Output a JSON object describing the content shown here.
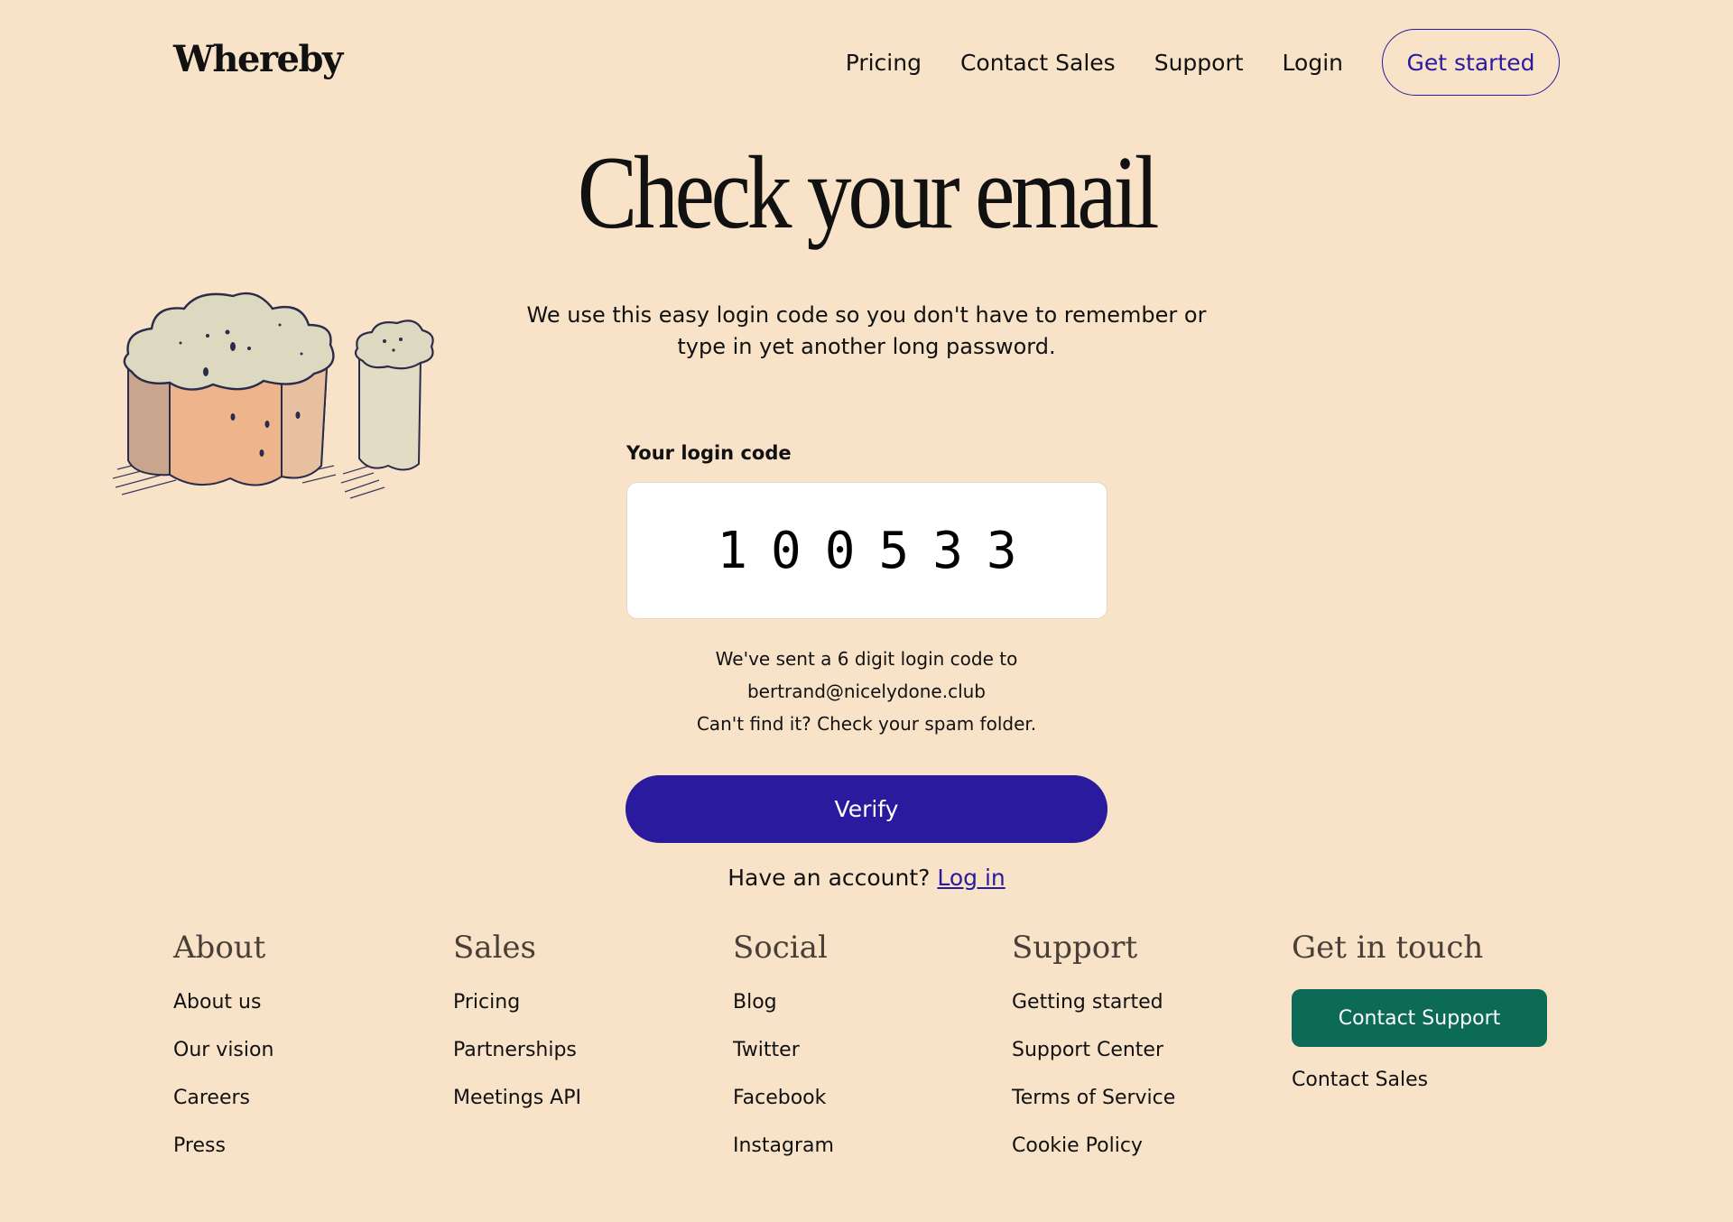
{
  "header": {
    "logo": "Whereby",
    "nav": [
      "Pricing",
      "Contact Sales",
      "Support",
      "Login"
    ],
    "cta": "Get started"
  },
  "main": {
    "title": "Check your email",
    "intro": "We use this easy login code so you don't have to remember or type in yet another long password.",
    "code_label": "Your login code",
    "code_value": "100533",
    "sent_line": "We've sent a 6 digit login code to",
    "email": "bertrand@nicelydone.club",
    "spam_hint": "Can't find it? Check your spam folder.",
    "verify_label": "Verify",
    "account_prompt": "Have an account?",
    "login_link": "Log in"
  },
  "footer": {
    "about": {
      "heading": "About",
      "links": [
        "About us",
        "Our vision",
        "Careers",
        "Press"
      ]
    },
    "sales": {
      "heading": "Sales",
      "links": [
        "Pricing",
        "Partnerships",
        "Meetings API"
      ]
    },
    "social": {
      "heading": "Social",
      "links": [
        "Blog",
        "Twitter",
        "Facebook",
        "Instagram"
      ]
    },
    "support": {
      "heading": "Support",
      "links": [
        "Getting started",
        "Support Center",
        "Terms of Service",
        "Cookie Policy"
      ]
    },
    "contact": {
      "heading": "Get in touch",
      "button": "Contact Support",
      "links": [
        "Contact Sales"
      ]
    }
  },
  "colors": {
    "background": "#f8e3c8",
    "accent": "#2a1a9e",
    "support_button": "#0b6b56"
  }
}
